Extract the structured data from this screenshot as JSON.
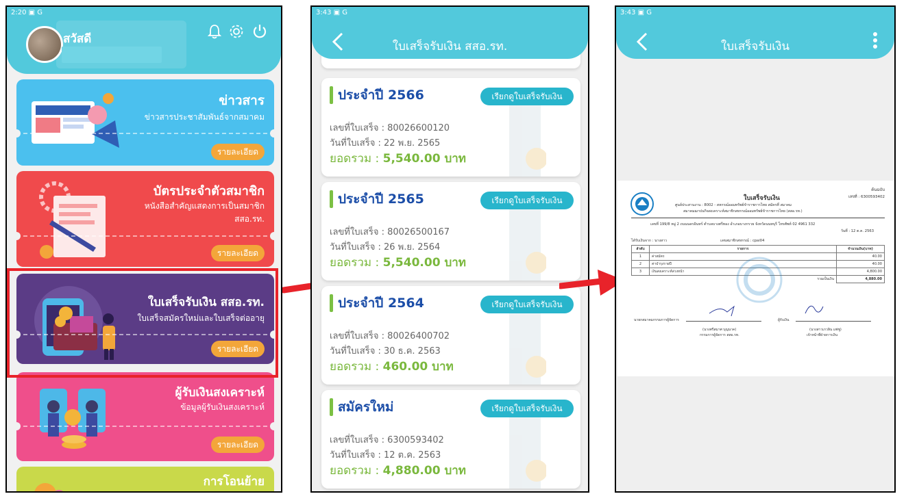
{
  "screen1": {
    "status_time": "2:20",
    "status_icons": "▣ G",
    "greeting": "สวัสดี",
    "cards": [
      {
        "title": "ข่าวสาร",
        "subtitle": "ข่าวสารประชาสัมพันธ์จากสมาคม",
        "button": "รายละเอียด",
        "color": "#4bc0ee"
      },
      {
        "title": "บัตรประจำตัวสมาชิก",
        "subtitle": "หนังสือสำคัญแสดงการเป็นสมาชิก สสอ.รท.",
        "button": "รายละเอียด",
        "color": "#f04a4c"
      },
      {
        "title": "ใบเสร็จรับเงิน สสอ.รท.",
        "subtitle": "ใบเสร็จสมัครใหม่และใบเสร็จต่ออายุ",
        "button": "รายละเอียด",
        "color": "#5b3c86"
      },
      {
        "title": "ผู้รับเงินสงเคราะห์",
        "subtitle": "ข้อมูลผู้รับเงินสงเคราะห์",
        "button": "รายละเอียด",
        "color": "#ef4f8b"
      },
      {
        "title": "การโอนย้าย",
        "subtitle": "",
        "button": "",
        "color": "#c9d94a"
      }
    ]
  },
  "screen2": {
    "status_time": "3:43",
    "status_icons": "▣ G",
    "title": "ใบเสร็จรับเงิน สสอ.รท.",
    "receipts": [
      {
        "heading": "ประจำปี 2566",
        "button": "เรียกดูใบเสร็จรับเงิน",
        "number_line": "เลขที่ใบเสร็จ : 80026600120",
        "date_line": "วันที่ใบเสร็จ : 22 พ.ย. 2565",
        "total_label": "ยอดรวม : ",
        "total_value": "5,540.00 บาท"
      },
      {
        "heading": "ประจำปี 2565",
        "button": "เรียกดูใบเสร็จรับเงิน",
        "number_line": "เลขที่ใบเสร็จ : 80026500167",
        "date_line": "วันที่ใบเสร็จ : 26 พ.ย. 2564",
        "total_label": "ยอดรวม : ",
        "total_value": "5,540.00 บาท"
      },
      {
        "heading": "ประจำปี 2564",
        "button": "เรียกดูใบเสร็จรับเงิน",
        "number_line": "เลขที่ใบเสร็จ : 80026400702",
        "date_line": "วันที่ใบเสร็จ : 30 ธ.ค. 2563",
        "total_label": "ยอดรวม : ",
        "total_value": "460.00 บาท"
      },
      {
        "heading": "สมัครใหม่",
        "button": "เรียกดูใบเสร็จรับเงิน",
        "number_line": "เลขที่ใบเสร็จ : 6300593402",
        "date_line": "วันที่ใบเสร็จ : 12 ต.ค. 2563",
        "total_label": "ยอดรวม : ",
        "total_value": "4,880.00 บาท"
      }
    ]
  },
  "screen3": {
    "status_time": "3:43",
    "status_icons": "▣ G",
    "title": "ใบเสร็จรับเงิน",
    "doc": {
      "corner": "ต้นฉบับ",
      "heading": "ใบเสร็จรับเงิน",
      "number": "เลขที่ : 6300593402",
      "line1": "ศูนย์ประสานงาน : 8002 - สหกรณ์ออมทรัพย์ข้าราชการไทย สมัครที่ สมาคม",
      "line2": "สมาคมฌาปนกิจสงเคราะห์สมาชิกสหกรณ์ออมทรัพย์ข้าราชการไทย (สสอ.รท.)",
      "address": "เลขที่ 199/8 หมู่ 2 ถนนนครอินทร์ ตำบลบางศรีทอง อำเภอบางกรวย จังหวัดนนทบุรี โทรศัพท์ 02 4961 332",
      "date": "วันที่ : 12 ต.ค. 2563",
      "received_from": "ได้รับเงินจาก : นางสาว",
      "member_no": "เลขสมาชิกสหกรณ์ : cpai04",
      "col_no": "ลำดับ",
      "col_item": "รายการ",
      "col_amount": "จำนวนเงิน(บาท)",
      "rows": [
        {
          "no": "1",
          "item": "ค่าสมัคร",
          "amount": "40.00"
        },
        {
          "no": "2",
          "item": "ค่าบำรุงรายปี",
          "amount": "40.00"
        },
        {
          "no": "3",
          "item": "เงินสงเคราะห์ล่วงหน้า",
          "amount": "4,800.00"
        }
      ],
      "total_label": "รวมเป็นเงิน",
      "total": "4,880.00",
      "sig_left_label": "นายกสมาคมกรรมการผู้จัดการ",
      "sig_right_label": "ผู้รับเงิน",
      "sig_left_name": "(นางศรีสมาศ บุญนาค)",
      "sig_left_role": "กรรมการผู้จัดการ สสอ.รท.",
      "sig_right_name": "(นางสาวเกวลิน แซ่ซู)",
      "sig_right_role": "เจ้าหน้าที่ฝ่ายการเงิน"
    }
  }
}
